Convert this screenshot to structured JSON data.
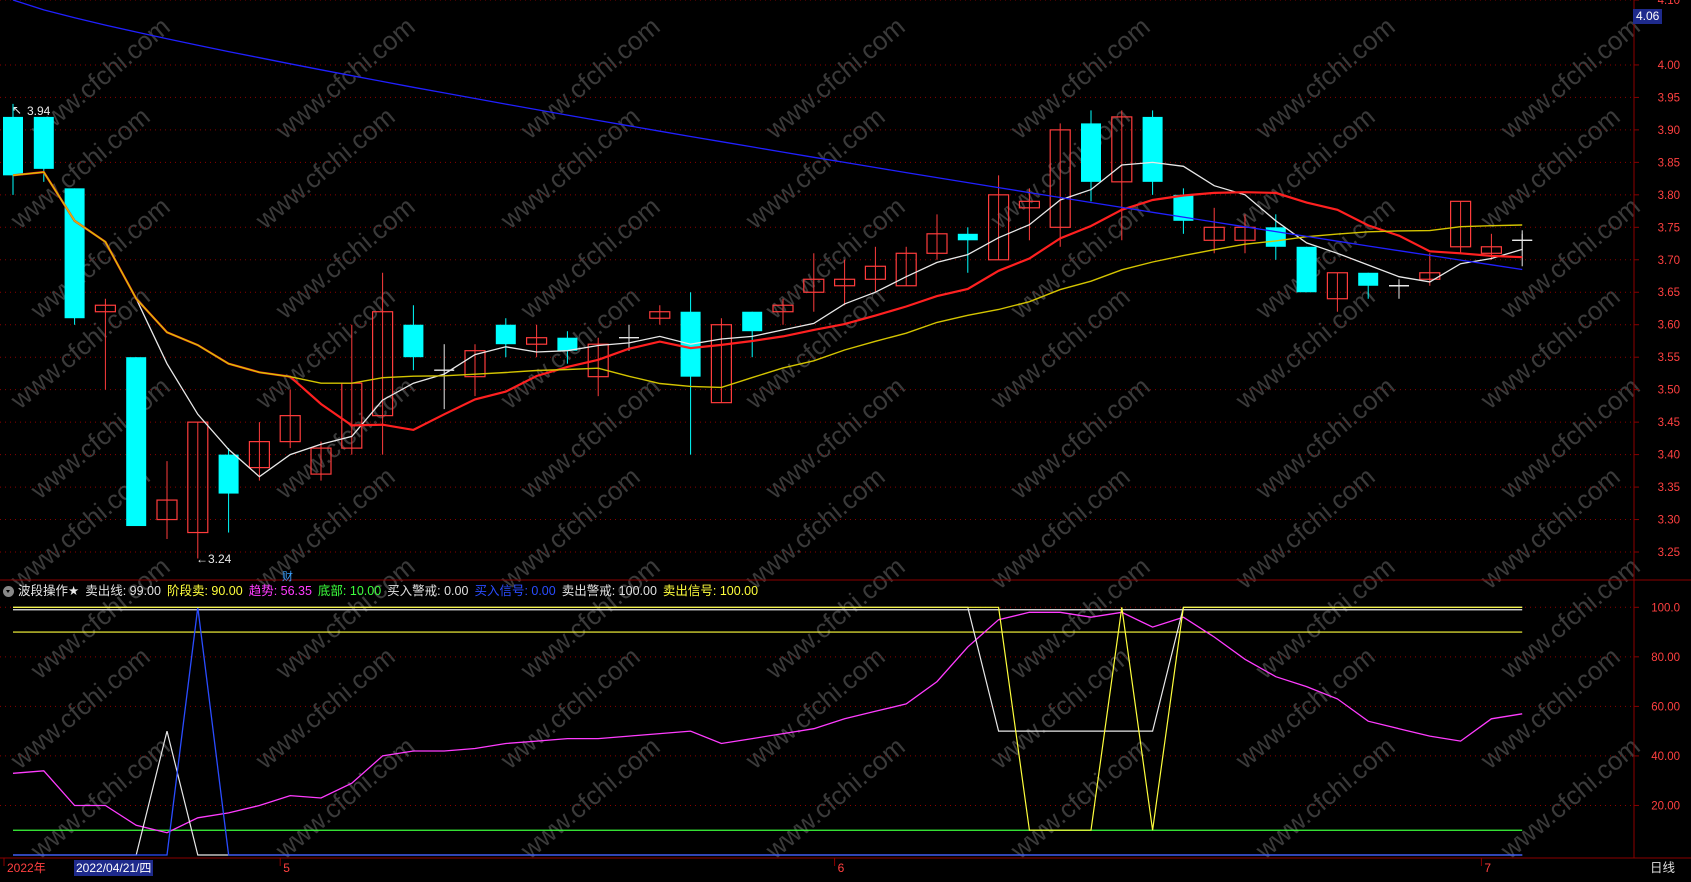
{
  "price_axis": {
    "ticks": [
      "4.10",
      "4.06",
      "4.00",
      "3.95",
      "3.90",
      "3.85",
      "3.80",
      "3.75",
      "3.70",
      "3.65",
      "3.60",
      "3.55",
      "3.50",
      "3.45",
      "3.40",
      "3.35",
      "3.30",
      "3.25"
    ]
  },
  "current_price_label": "4.06",
  "high_label": "3.94",
  "low_label": "←3.24",
  "caiwu_marker": "财",
  "indicator": {
    "name": "波段操作★",
    "items": [
      {
        "label": "卖出线: 99.00",
        "color": "#e0e0e0"
      },
      {
        "label": "阶段卖: 90.00",
        "color": "#ffff3c"
      },
      {
        "label": "趋势: 56.35",
        "color": "#ff3cff"
      },
      {
        "label": "底部: 10.00",
        "color": "#3cff3c"
      },
      {
        "label": "买入警戒: 0.00",
        "color": "#e0e0e0"
      },
      {
        "label": "买入信号: 0.00",
        "color": "#2a4cff"
      },
      {
        "label": "卖出警戒: 100.00",
        "color": "#e0e0e0"
      },
      {
        "label": "卖出信号: 100.00",
        "color": "#ffff3c"
      }
    ],
    "axis_ticks": [
      "100.0",
      "80.00",
      "60.00",
      "40.00",
      "20.00"
    ]
  },
  "time_axis": {
    "labels": [
      "2022年",
      "5",
      "6",
      "7"
    ],
    "cursor_date": "2022/04/21/四"
  },
  "period_tab": "日线",
  "colors": {
    "up": "#ff3c3c",
    "down": "#00ffff",
    "grid": "#8b0000",
    "ma_white": "#e8e8e8",
    "ma_red": "#ff2020",
    "ma_yellow": "#d4c400",
    "ma_blue": "#2020ff"
  },
  "watermark": "www.cfchi.com",
  "chart_data": {
    "type": "candlestick",
    "ylim": [
      3.21,
      4.1
    ],
    "candles": [
      [
        3.92,
        3.83,
        3.94,
        3.8
      ],
      [
        3.92,
        3.84,
        3.92,
        3.82
      ],
      [
        3.81,
        3.61,
        3.81,
        3.6
      ],
      [
        3.62,
        3.63,
        3.64,
        3.5
      ],
      [
        3.55,
        3.29,
        3.55,
        3.29
      ],
      [
        3.3,
        3.33,
        3.39,
        3.27
      ],
      [
        3.28,
        3.45,
        3.45,
        3.24
      ],
      [
        3.4,
        3.34,
        3.41,
        3.28
      ],
      [
        3.38,
        3.42,
        3.45,
        3.36
      ],
      [
        3.42,
        3.46,
        3.5,
        3.41
      ],
      [
        3.37,
        3.41,
        3.42,
        3.36
      ],
      [
        3.41,
        3.51,
        3.6,
        3.4
      ],
      [
        3.46,
        3.62,
        3.68,
        3.4
      ],
      [
        3.6,
        3.55,
        3.63,
        3.53
      ],
      [
        3.53,
        3.53,
        3.57,
        3.47
      ],
      [
        3.52,
        3.56,
        3.57,
        3.49
      ],
      [
        3.6,
        3.57,
        3.61,
        3.55
      ],
      [
        3.57,
        3.58,
        3.6,
        3.55
      ],
      [
        3.58,
        3.56,
        3.59,
        3.54
      ],
      [
        3.52,
        3.57,
        3.58,
        3.49
      ],
      [
        3.58,
        3.58,
        3.6,
        3.56
      ],
      [
        3.61,
        3.62,
        3.63,
        3.6
      ],
      [
        3.62,
        3.52,
        3.65,
        3.4
      ],
      [
        3.48,
        3.6,
        3.61,
        3.48
      ],
      [
        3.62,
        3.59,
        3.62,
        3.55
      ],
      [
        3.62,
        3.63,
        3.64,
        3.6
      ],
      [
        3.65,
        3.67,
        3.71,
        3.62
      ],
      [
        3.66,
        3.67,
        3.7,
        3.63
      ],
      [
        3.67,
        3.69,
        3.72,
        3.65
      ],
      [
        3.66,
        3.71,
        3.72,
        3.66
      ],
      [
        3.71,
        3.74,
        3.77,
        3.7
      ],
      [
        3.74,
        3.73,
        3.75,
        3.68
      ],
      [
        3.7,
        3.8,
        3.83,
        3.7
      ],
      [
        3.78,
        3.79,
        3.81,
        3.73
      ],
      [
        3.75,
        3.9,
        3.91,
        3.72
      ],
      [
        3.91,
        3.82,
        3.93,
        3.79
      ],
      [
        3.82,
        3.92,
        3.93,
        3.73
      ],
      [
        3.92,
        3.82,
        3.93,
        3.8
      ],
      [
        3.8,
        3.76,
        3.81,
        3.74
      ],
      [
        3.73,
        3.75,
        3.78,
        3.71
      ],
      [
        3.73,
        3.75,
        3.77,
        3.71
      ],
      [
        3.75,
        3.72,
        3.77,
        3.7
      ],
      [
        3.72,
        3.65,
        3.72,
        3.65
      ],
      [
        3.64,
        3.68,
        3.68,
        3.62
      ],
      [
        3.68,
        3.66,
        3.68,
        3.64
      ],
      [
        3.66,
        3.66,
        3.67,
        3.64
      ],
      [
        3.67,
        3.68,
        3.71,
        3.66
      ],
      [
        3.72,
        3.79,
        3.79,
        3.71
      ],
      [
        3.71,
        3.72,
        3.74,
        3.7
      ],
      [
        3.73,
        3.73,
        3.74,
        3.69
      ]
    ]
  }
}
